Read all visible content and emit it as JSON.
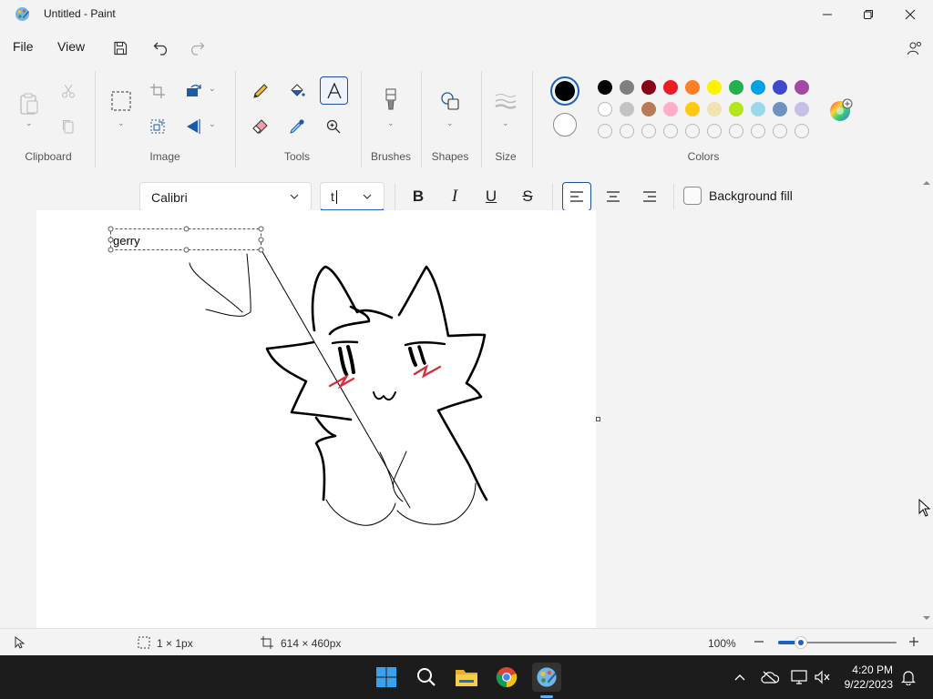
{
  "window": {
    "title": "Untitled - Paint"
  },
  "menu": {
    "file": "File",
    "view": "View"
  },
  "ribbon": {
    "groups": {
      "clipboard": "Clipboard",
      "image": "Image",
      "tools": "Tools",
      "brushes": "Brushes",
      "shapes": "Shapes",
      "size": "Size",
      "colors": "Colors"
    },
    "active_tool": "text",
    "primary_color": "#000000",
    "secondary_color": "#ffffff",
    "palette_row1": [
      "#000000",
      "#7f7f7f",
      "#880015",
      "#ed1c24",
      "#ff7f27",
      "#fff200",
      "#22b14c",
      "#00a2e8",
      "#3f48cc",
      "#a349a4"
    ],
    "palette_row2": [
      "#ffffff",
      "#c3c3c3",
      "#b97a57",
      "#ffaec9",
      "#ffc90e",
      "#efe4b0",
      "#b5e61d",
      "#99d9ea",
      "#7092be",
      "#c8bfe7"
    ],
    "palette_row3_count": 10
  },
  "textbar": {
    "font": "Calibri",
    "size": "t",
    "bold": "B",
    "italic": "I",
    "underline": "U",
    "strike": "S",
    "background_fill": "Background fill"
  },
  "canvas": {
    "text_box_content": "gerry",
    "drawing_color": "#000000",
    "blush_color": "#d6303e"
  },
  "status": {
    "selection_size": "1 × 1px",
    "canvas_size": "614 × 460px",
    "zoom": "100%",
    "zoom_level": 0.5
  },
  "taskbar": {
    "time": "4:20 PM",
    "date": "9/22/2023"
  }
}
